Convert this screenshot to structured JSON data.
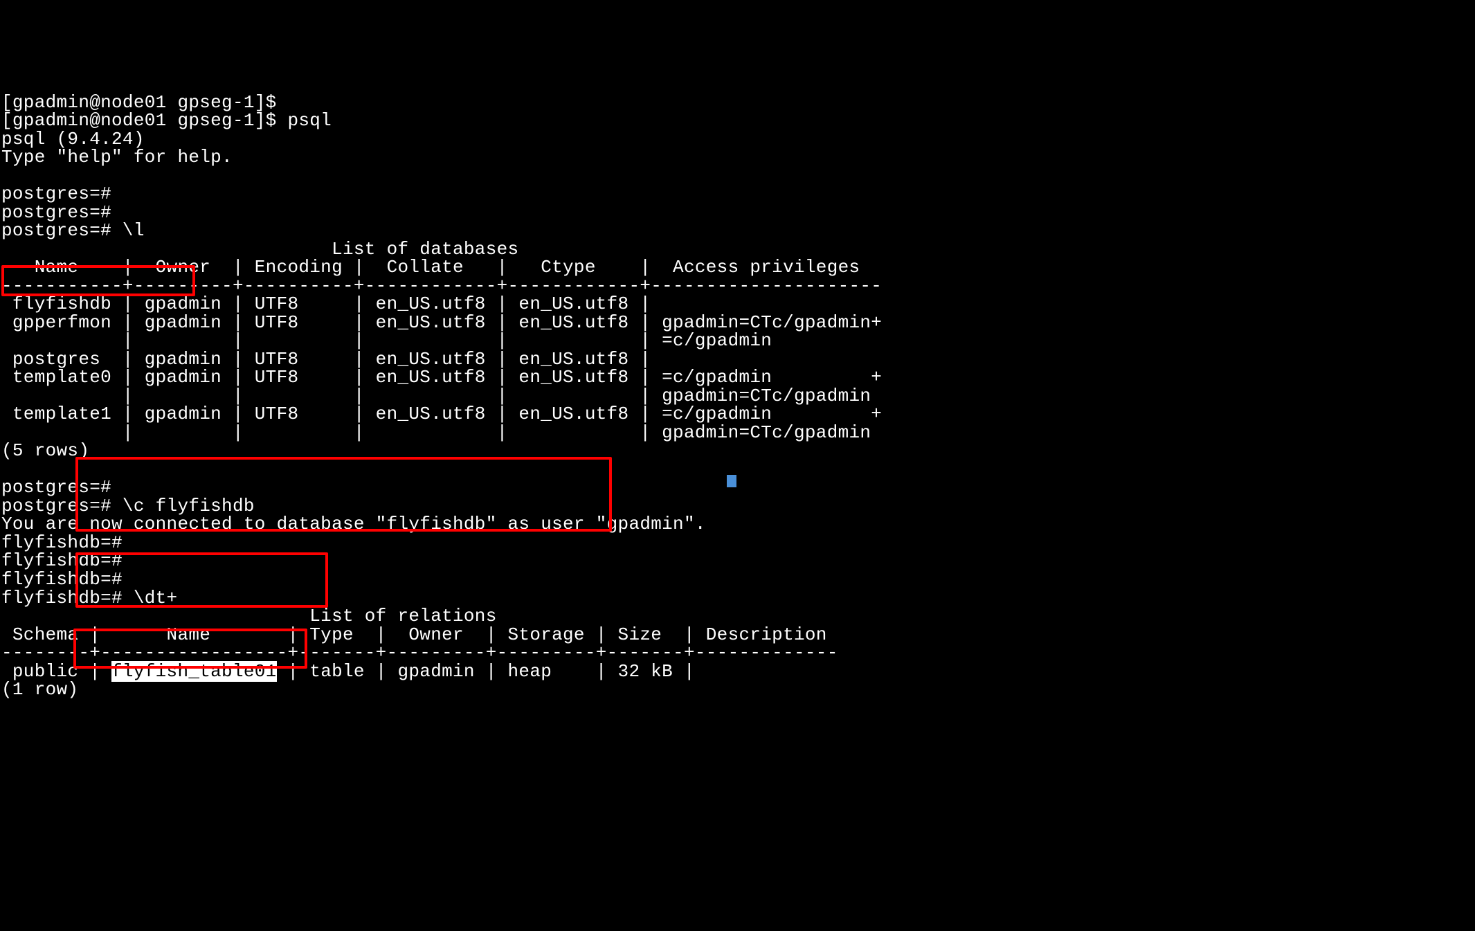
{
  "terminal": {
    "prompt_lines": [
      "[gpadmin@node01 gpseg-1]$",
      "[gpadmin@node01 gpseg-1]$ psql",
      "psql (9.4.24)",
      "Type \"help\" for help.",
      "",
      "postgres=#",
      "postgres=#",
      "postgres=# \\l"
    ],
    "db_list": {
      "title": "                              List of databases",
      "header": "   Name    |  Owner  | Encoding |  Collate   |   Ctype    |  Access privileges  ",
      "separator": "-----------+---------+----------+------------+------------+---------------------",
      "rows": [
        " flyfishdb | gpadmin | UTF8     | en_US.utf8 | en_US.utf8 | ",
        " gpperfmon | gpadmin | UTF8     | en_US.utf8 | en_US.utf8 | gpadmin=CTc/gpadmin+",
        "           |         |          |            |            | =c/gpadmin",
        " postgres  | gpadmin | UTF8     | en_US.utf8 | en_US.utf8 | ",
        " template0 | gpadmin | UTF8     | en_US.utf8 | en_US.utf8 | =c/gpadmin         +",
        "           |         |          |            |            | gpadmin=CTc/gpadmin",
        " template1 | gpadmin | UTF8     | en_US.utf8 | en_US.utf8 | =c/gpadmin         +",
        "           |         |          |            |            | gpadmin=CTc/gpadmin"
      ],
      "footer": "(5 rows)"
    },
    "connect_lines": [
      "",
      "postgres=#",
      "postgres=# \\c flyfishdb",
      "You are now connected to database \"flyfishdb\" as user \"gpadmin\".",
      "flyfishdb=#",
      "flyfishdb=#",
      "flyfishdb=#",
      "flyfishdb=# \\dt+"
    ],
    "rel_list": {
      "title": "                            List of relations",
      "header": " Schema |      Name       | Type  |  Owner  | Storage | Size  | Description ",
      "separator": "--------+-----------------+-------+---------+---------+-------+-------------",
      "row_prefix": " public | ",
      "selected": "flyfish_table01",
      "row_suffix": " | table | gpadmin | heap    | 32 kB | ",
      "footer": "(1 row)"
    }
  }
}
